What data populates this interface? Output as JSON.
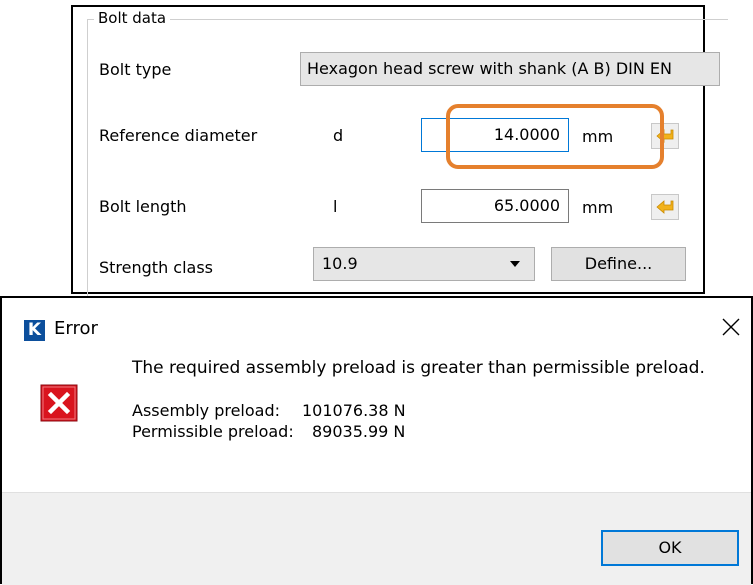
{
  "bolt_panel": {
    "group_title": "Bolt data",
    "bolt_type": {
      "label": "Bolt type",
      "value": "Hexagon head screw with shank (A B) DIN EN"
    },
    "reference_diameter": {
      "label": "Reference diameter",
      "symbol": "d",
      "value": "14.0000",
      "unit": "mm"
    },
    "bolt_length": {
      "label": "Bolt length",
      "symbol": "l",
      "value": "65.0000",
      "unit": "mm"
    },
    "strength_class": {
      "label": "Strength class",
      "value": "10.9",
      "define_label": "Define..."
    }
  },
  "error_dialog": {
    "title": "Error",
    "logo_letter": "K",
    "message": "The required assembly preload is greater than permissible preload.",
    "assembly_preload": {
      "label": "Assembly preload:",
      "value": "101076.38 N"
    },
    "permissible_preload": {
      "label": "Permissible preload:",
      "value": "89035.99 N"
    },
    "ok_label": "OK"
  },
  "colors": {
    "highlight": "#e5802d",
    "focus_border": "#0078d7",
    "arrow_icon": "#f2b21c",
    "error_red": "#d9141e",
    "logo_blue": "#0c4f9c"
  },
  "icons": [
    "arrow-left-icon",
    "dropdown-arrow-icon",
    "close-icon",
    "error-icon"
  ]
}
